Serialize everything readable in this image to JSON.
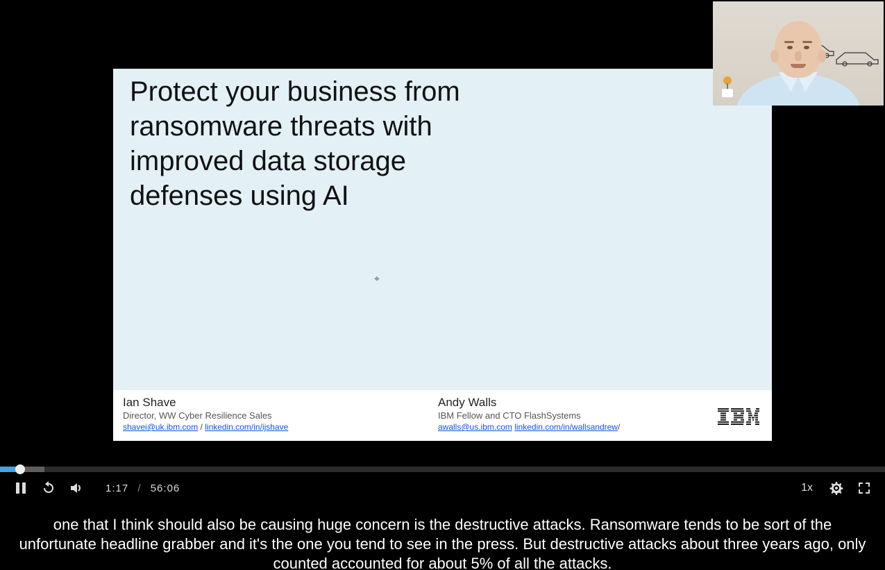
{
  "slide": {
    "title": "Protect your business from ransomware threats with improved data storage defenses using AI",
    "presenter1": {
      "name": "Ian Shave",
      "title": "Director, WW Cyber Resilience Sales",
      "email": "shavei@uk.ibm.com",
      "linkedin": "linkedin.com/in/ijshave"
    },
    "presenter2": {
      "name": "Andy Walls",
      "title": "IBM Fellow and CTO FlashSystems",
      "email": "awalls@us.ibm.com",
      "linkedin": "linkedin.com/in/wallsandrew",
      "linkedin_suffix": "/"
    },
    "logo_text": "IBM"
  },
  "player": {
    "current_time": "1:17",
    "duration": "56:06",
    "time_separator": "/",
    "speed_label": "1x",
    "progress_percent": 2.3,
    "buffered_percent": 5
  },
  "captions": {
    "text": "one that I think should also be causing huge concern is the destructive attacks. Ransomware tends to be sort of the unfortunate headline grabber and it's the one you tend to see in the press. But destructive attacks about three years ago, only counted accounted for about 5% of all the attacks."
  },
  "link_separator": " / "
}
